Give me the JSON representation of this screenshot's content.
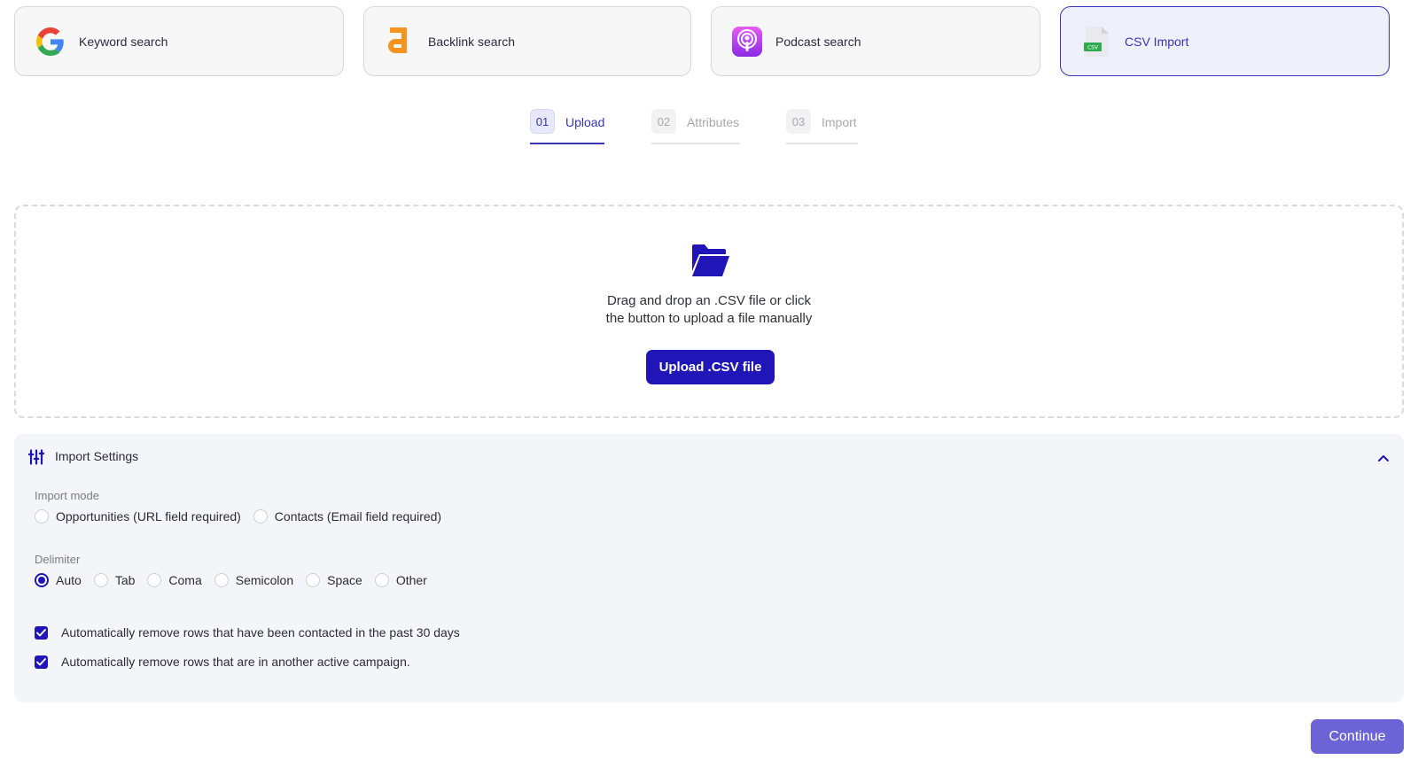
{
  "sources": [
    {
      "label": "Keyword search",
      "icon": "google-icon",
      "active": false
    },
    {
      "label": "Backlink search",
      "icon": "ahrefs-icon",
      "active": false
    },
    {
      "label": "Podcast search",
      "icon": "podcast-icon",
      "active": false
    },
    {
      "label": "CSV Import",
      "icon": "csv-file-icon",
      "active": true
    }
  ],
  "steps": [
    {
      "num": "01",
      "label": "Upload",
      "active": true
    },
    {
      "num": "02",
      "label": "Attributes",
      "active": false
    },
    {
      "num": "03",
      "label": "Import",
      "active": false
    }
  ],
  "dropzone": {
    "icon": "folder-open-icon",
    "line1": "Drag and drop an .CSV file or click",
    "line2": "the button to upload a file manually",
    "button": "Upload .CSV file"
  },
  "settings": {
    "title": "Import Settings",
    "icon": "sliders-icon",
    "import_mode": {
      "label": "Import mode",
      "options": [
        "Opportunities (URL field required)",
        "Contacts (Email field required)"
      ],
      "selected": null
    },
    "delimiter": {
      "label": "Delimiter",
      "options": [
        "Auto",
        "Tab",
        "Coma",
        "Semicolon",
        "Space",
        "Other"
      ],
      "selected": "Auto"
    },
    "checks": [
      {
        "label": "Automatically remove rows that have been contacted in the past 30 days",
        "checked": true
      },
      {
        "label": "Automatically remove rows that are in another active campaign.",
        "checked": true
      }
    ]
  },
  "footer": {
    "continue": "Continue"
  },
  "colors": {
    "primary": "#2016b8",
    "accent": "#3a34b8",
    "continue_bg": "#6b63d6",
    "panel_bg": "#f4f5f8"
  }
}
